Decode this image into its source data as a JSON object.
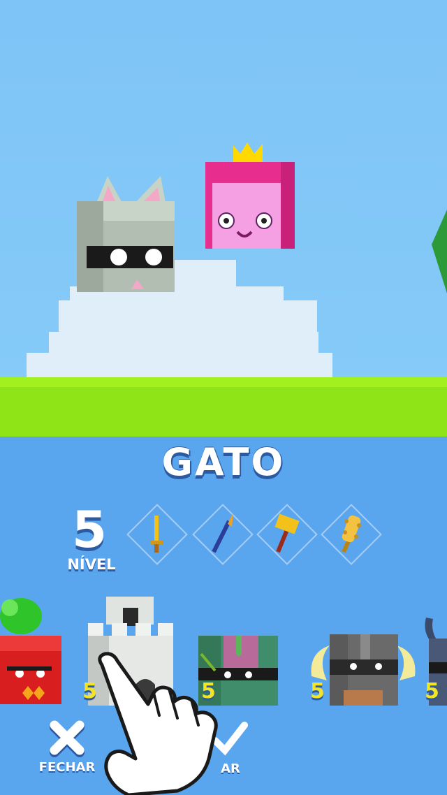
{
  "character": {
    "name": "GATO",
    "level": "5",
    "level_label": "NÍVEL"
  },
  "weapons": [
    {
      "icon": "sword-icon"
    },
    {
      "icon": "spear-icon"
    },
    {
      "icon": "hammer-icon"
    },
    {
      "icon": "spiked-club-icon"
    }
  ],
  "carousel": [
    {
      "icon": "red-radish-character",
      "level": ""
    },
    {
      "icon": "castle-tower-character",
      "level": "5"
    },
    {
      "icon": "goblin-character",
      "level": "5"
    },
    {
      "icon": "viking-helmet-character",
      "level": "5"
    },
    {
      "icon": "dark-horned-character",
      "level": "5"
    }
  ],
  "buttons": {
    "close_label": "FECHAR",
    "confirm_label": "AR"
  },
  "colors": {
    "sky": "#7ec4f6",
    "grass": "#8ee417",
    "panel": "#5aa6ee",
    "badge": "#f3e428"
  }
}
